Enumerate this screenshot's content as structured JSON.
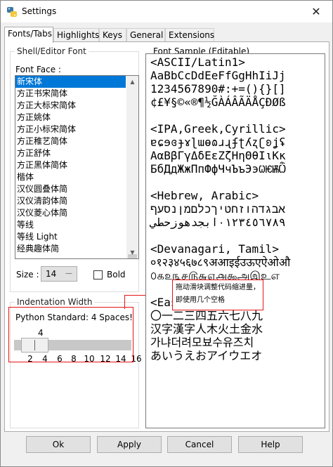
{
  "window": {
    "title": "Settings"
  },
  "tabs": [
    {
      "label": "Fonts/Tabs"
    },
    {
      "label": "Highlights"
    },
    {
      "label": "Keys"
    },
    {
      "label": "General"
    },
    {
      "label": "Extensions"
    }
  ],
  "shell_font": {
    "group_label": "Shell/Editor Font",
    "font_face_label": "Font Face :",
    "fonts": [
      "新宋体",
      "方正书宋简体",
      "方正大标宋简体",
      "方正姚体",
      "方正小标宋简体",
      "方正稚艺简体",
      "方正舒体",
      "方正黑体简体",
      "楷体",
      "汉仪圆叠体简",
      "汉仪清韵体简",
      "汉仪菱心体简",
      "等线",
      "等线 Light",
      "经典趣体简"
    ],
    "selected_index": 0,
    "size_label": "Size :",
    "size_value": "14",
    "bold_label": "Bold"
  },
  "indentation": {
    "group_label": "Indentation Width",
    "python_standard": "Python Standard: 4 Spaces!",
    "value": "4",
    "ticks": [
      "2",
      "4",
      "6",
      "8",
      "10",
      "12",
      "14",
      "16"
    ]
  },
  "annotation": {
    "text": "拖动滑块调整代码缩进量，即使用几个空格"
  },
  "sample": {
    "label": "Font Sample (Editable)",
    "text": "<ASCII/Latin1>\nAaBbCcDdEeFfGgHhIiJj\n1234567890#:+=(){}[]\n¢£¥§©«®¶½ĞÀÁÂÃÄÅÇÐØß\n\n<IPA,Greek,Cyrillic>\nɐɕɘɞɟɤɭɯɵɷɹɻʄʈʎʐʗʚʝʢ\nΑαΒβΓγΔδΕεΖζΗηΘθΙιΚκ\nБбДдЖжПпФфЧчЪъЭэѠѤѬѼ\n\n<Hebrew, Arabic>\nאבגדהוזחטיךכלםמןנסעף\n٠١٢٣٤٥٦٧٨٩ابجدهوزحطي\n\n<Devanagari, Tamil>\n०१२३४५६७८९अआइईउऊएऐओऔ\n௦௧௨௩௪௫௬௭௮௯அஇஉஎ\n\n<East Asian>\n〇一二三四五六七八九\n汉字漢字人木火土金水\n가냐더려모뵤수유즈치\nあいうえおアイウエオ"
  },
  "buttons": {
    "ok": "Ok",
    "apply": "Apply",
    "cancel": "Cancel",
    "help": "Help"
  }
}
